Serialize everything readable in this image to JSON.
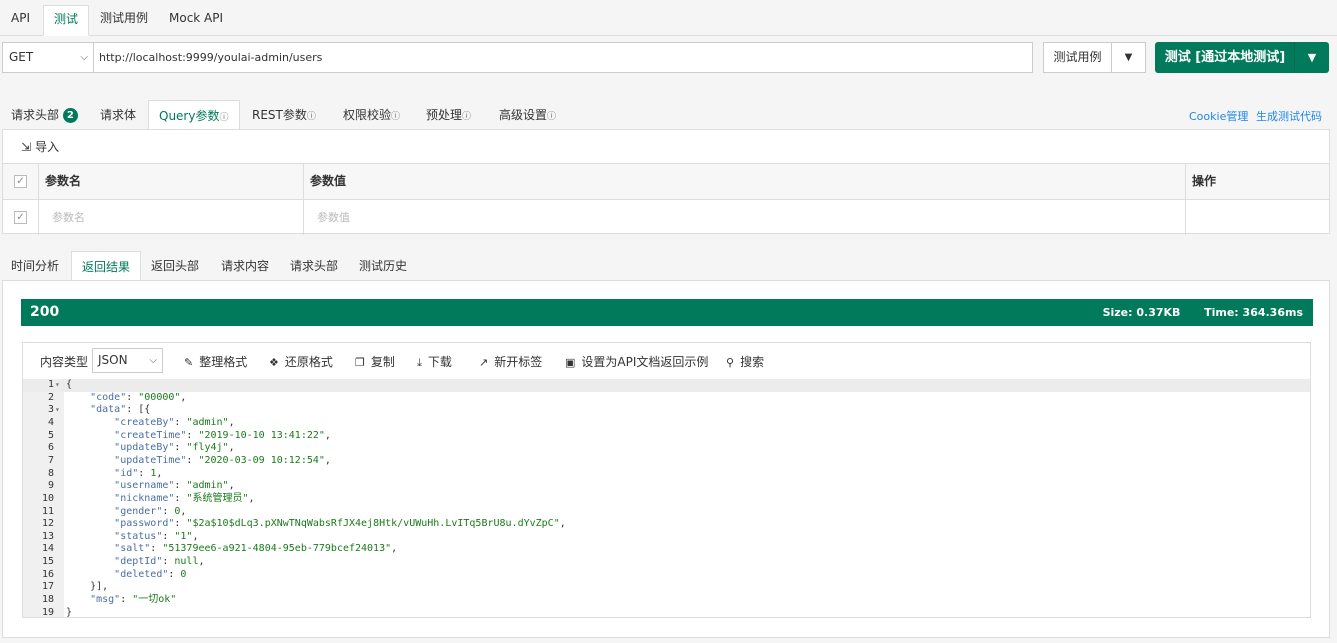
{
  "top_tabs": [
    "API",
    "测试",
    "测试用例",
    "Mock API"
  ],
  "request": {
    "method": "GET",
    "url": "http://localhost:9999/youlai-admin/users",
    "case_button": "测试用例",
    "send_button": "测试 [通过本地测试]"
  },
  "request_tabs": {
    "headers": "请求头部",
    "headers_count": "2",
    "body": "请求体",
    "query": "Query参数",
    "rest": "REST参数",
    "auth": "权限校验",
    "pre": "预处理",
    "advanced": "高级设置",
    "info_glyph": "ⓘ"
  },
  "links": {
    "cookie": "Cookie管理",
    "gen_code": "生成测试代码"
  },
  "params": {
    "import": "导入",
    "headers": {
      "name": "参数名",
      "value": "参数值",
      "action": "操作"
    },
    "row_placeholder": {
      "name": "参数名",
      "value": "参数值"
    }
  },
  "response_tabs": [
    "时间分析",
    "返回结果",
    "返回头部",
    "请求内容",
    "请求头部",
    "测试历史"
  ],
  "status": {
    "code": "200",
    "size": "Size:  0.37KB",
    "time": "Time:  364.36ms"
  },
  "toolbar": {
    "content_type_label": "内容类型",
    "content_type": "JSON",
    "format": "整理格式",
    "restore": "还原格式",
    "copy": "复制",
    "download": "下载",
    "new_tab": "新开标签",
    "set_example": "设置为API文档返回示例",
    "search": "搜索"
  },
  "code_lines": [
    "{",
    "    \"code\": \"00000\",",
    "    \"data\": [{",
    "        \"createBy\": \"admin\",",
    "        \"createTime\": \"2019-10-10 13:41:22\",",
    "        \"updateBy\": \"fly4j\",",
    "        \"updateTime\": \"2020-03-09 10:12:54\",",
    "        \"id\": 1,",
    "        \"username\": \"admin\",",
    "        \"nickname\": \"系统管理员\",",
    "        \"gender\": 0,",
    "        \"password\": \"$2a$10$dLq3.pXNwTNqWabsRfJX4ej8Htk/vUWuHh.LvITq5BrU8u.dYvZpC\",",
    "        \"status\": \"1\",",
    "        \"salt\": \"51379ee6-a921-4804-95eb-779bcef24013\",",
    "        \"deptId\": null,",
    "        \"deleted\": 0",
    "    }],",
    "    \"msg\": \"一切ok\"",
    "}"
  ],
  "fold_lines": [
    1,
    3
  ]
}
